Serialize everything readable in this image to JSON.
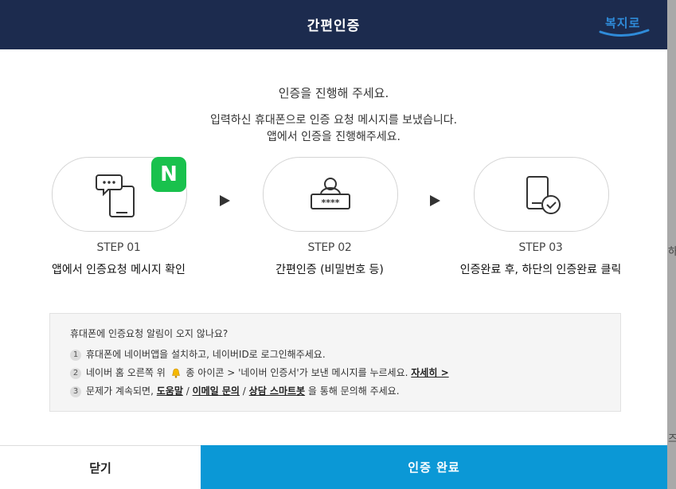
{
  "backdrop": {
    "right_text_1": "하",
    "right_text_2": "즈"
  },
  "header": {
    "title": "간편인증",
    "logo_text": "복지로"
  },
  "intro": {
    "line1": "인증을 진행해 주세요.",
    "line2": "입력하신 휴대폰으로 인증 요청 메시지를 보냈습니다.",
    "line3": "앱에서 인증을 진행해주세요."
  },
  "steps": [
    {
      "num": "STEP 01",
      "desc": "앱에서 인증요청 메시지 확인",
      "icon": "phone-chat-icon"
    },
    {
      "num": "STEP 02",
      "desc": "간편인증 (비밀번호 등)",
      "icon": "password-user-icon"
    },
    {
      "num": "STEP 03",
      "desc": "인증완료 후, 하단의 인증완료 클릭",
      "icon": "phone-check-icon"
    }
  ],
  "naver_badge": "N",
  "notice": {
    "title": "휴대폰에 인증요청 알림이 오지 않나요?",
    "item1_num": "1",
    "item1": "휴대폰에 네이버앱을 설치하고, 네이버ID로 로그인해주세요.",
    "item2_num": "2",
    "item2_before": "네이버 홈 오른쪽 위",
    "item2_after": "종 아이콘 > '네이버 인증서'가 보낸 메시지를 누르세요.",
    "item2_link": "자세히 >",
    "item3_num": "3",
    "item3_before": "문제가 계속되면,",
    "item3_link1": "도움말",
    "item3_sep1": "/",
    "item3_link2": "이메일 문의",
    "item3_sep2": "/",
    "item3_link3": "상담 스마트봇",
    "item3_after": "을 통해 문의해 주세요."
  },
  "footer": {
    "close_label": "닫기",
    "done_label": "인증 완료"
  },
  "colors": {
    "header_bg": "#1c2b4e",
    "primary_button": "#0b98d6",
    "naver_green": "#19c14d"
  }
}
